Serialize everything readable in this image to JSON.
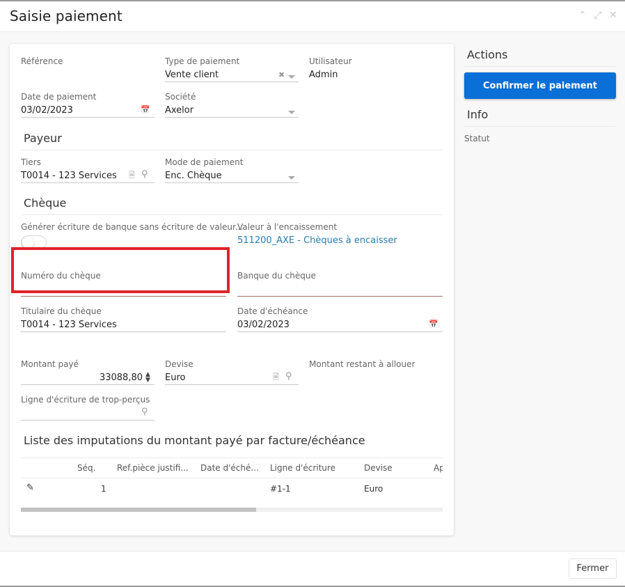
{
  "window": {
    "title": "Saisie paiement",
    "controls": [
      "collapse",
      "maximize",
      "close"
    ]
  },
  "form": {
    "reference": {
      "label": "Référence",
      "value": ""
    },
    "payment_type": {
      "label": "Type de paiement",
      "value": "Vente client"
    },
    "user": {
      "label": "Utilisateur",
      "value": "Admin"
    },
    "payment_date": {
      "label": "Date de paiement",
      "value": "03/02/2023"
    },
    "company": {
      "label": "Société",
      "value": "Axelor"
    },
    "payer_section": "Payeur",
    "partner": {
      "label": "Tiers",
      "value": "T0014 - 123 Services"
    },
    "payment_mode": {
      "label": "Mode de paiement",
      "value": "Enc. Chèque"
    },
    "cheque_section": "Chèque",
    "bank_entry_toggle": {
      "label": "Générer écriture de banque sans écriture de valeur...",
      "checked": false
    },
    "value_for_collection": {
      "label": "Valeur à l'encaissement",
      "value": "511200_AXE - Chèques à encaisser"
    },
    "cheque_number": {
      "label": "Numéro du chèque",
      "value": ""
    },
    "cheque_bank": {
      "label": "Banque du chèque",
      "value": ""
    },
    "cheque_owner": {
      "label": "Titulaire du chèque",
      "value": "T0014 - 123 Services"
    },
    "due_date": {
      "label": "Date d'échéance",
      "value": "03/02/2023"
    },
    "amount_paid": {
      "label": "Montant payé",
      "value": "33088,80"
    },
    "currency": {
      "label": "Devise",
      "value": "Euro"
    },
    "remaining_amount": {
      "label": "Montant restant à allouer",
      "value": ""
    },
    "overpaid_line": {
      "label": "Ligne d'écriture de trop-perçus",
      "value": ""
    }
  },
  "imputations": {
    "title": "Liste des imputations du montant payé par facture/échéance",
    "columns": [
      "Séq.",
      "Ref.pièce justifi...",
      "Date d'éché...",
      "Ligne d'écriture",
      "Devise",
      "Ap"
    ],
    "rows": [
      {
        "seq": "1",
        "ref": "",
        "due_date": "",
        "move_line": "#1-1",
        "currency": "Euro"
      }
    ],
    "scroll_position": 0
  },
  "sidebar": {
    "actions_title": "Actions",
    "confirm_label": "Confirmer le paiement",
    "info_title": "Info",
    "status_label": "Statut",
    "accent_color": "#0a6fd6"
  },
  "footer": {
    "close_label": "Fermer"
  },
  "highlight_color": "#e0222a"
}
